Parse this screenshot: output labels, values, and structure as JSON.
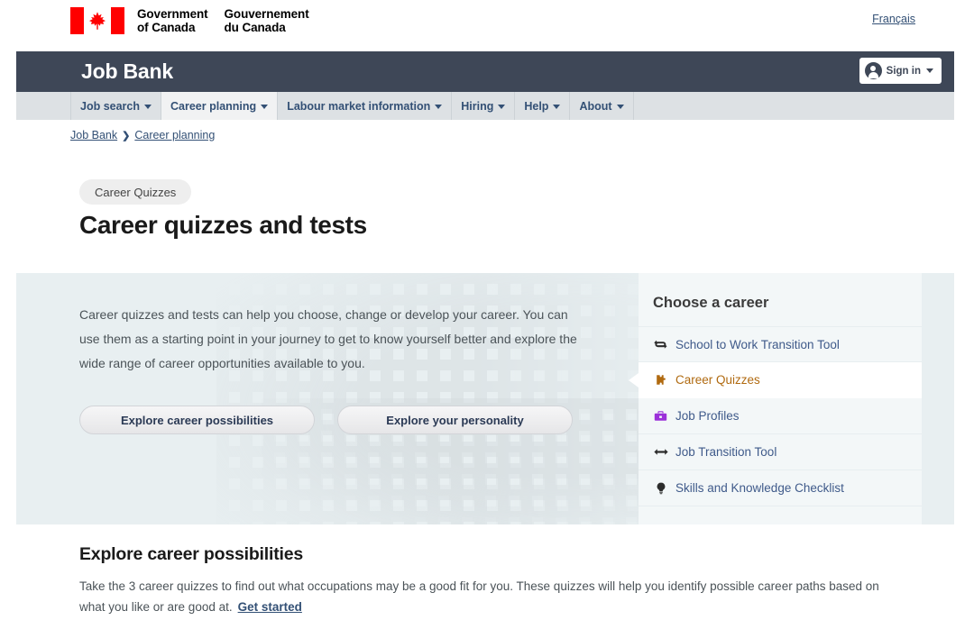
{
  "goc": {
    "government_en": "Government\nof Canada",
    "government_fr": "Gouvernement\ndu Canada",
    "flag_icon": "canada-flag-icon",
    "lang_toggle": "Français"
  },
  "appbar": {
    "title": "Job Bank",
    "signin_label": "Sign in",
    "signin_icon": "user-avatar-icon",
    "caret_icon": "chevron-down-icon",
    "background": "#3e4757"
  },
  "menu": {
    "items": [
      {
        "label": "Job search",
        "active": false
      },
      {
        "label": "Career planning",
        "active": true
      },
      {
        "label": "Labour market information",
        "active": false
      },
      {
        "label": "Hiring",
        "active": false
      },
      {
        "label": "Help",
        "active": false
      },
      {
        "label": "About",
        "active": false
      }
    ],
    "background": "#dde1e4"
  },
  "breadcrumb": {
    "items": [
      "Job Bank",
      "Career planning"
    ],
    "separator": "❯"
  },
  "page": {
    "badge": "Career Quizzes",
    "title": "Career quizzes and tests"
  },
  "hero": {
    "background": "#e8eff1",
    "paragraph": "Career quizzes and tests can help you choose, change or develop your career. You can use them as a starting point in your journey to get to know yourself better and explore the wide range of career opportunities available to you.",
    "buttons": [
      {
        "label": "Explore career possibilities"
      },
      {
        "label": "Explore your personality"
      }
    ]
  },
  "career_panel": {
    "title": "Choose a career",
    "items": [
      {
        "label": "School to Work Transition Tool",
        "icon": "loop-arrows-icon",
        "glyph": "↻",
        "color": "#2c2c2c",
        "active": false
      },
      {
        "label": "Career Quizzes",
        "icon": "puzzle-piece-icon",
        "glyph": "◼",
        "color": "#b06a10",
        "active": true
      },
      {
        "label": "Job Profiles",
        "icon": "briefcase-icon",
        "glyph": "◼",
        "color": "#9b30d9",
        "active": false
      },
      {
        "label": "Job Transition Tool",
        "icon": "left-right-arrow-icon",
        "glyph": "↔",
        "color": "#2c2c2c",
        "active": false
      },
      {
        "label": "Skills and Knowledge Checklist",
        "icon": "lightbulb-icon",
        "glyph": "◍",
        "color": "#2c2c2c",
        "active": false
      }
    ]
  },
  "section": {
    "heading": "Explore career possibilities",
    "paragraph": "Take the 3 career quizzes to find out what occupations may be a good fit for you. These quizzes will help you identify possible career paths based on what you like or are good at.",
    "link": "Get started"
  }
}
